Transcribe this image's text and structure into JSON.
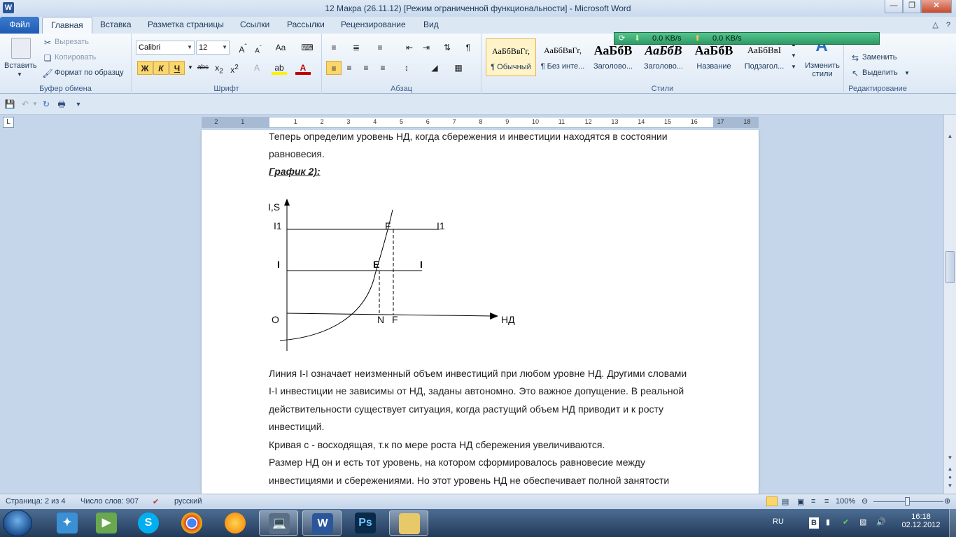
{
  "window": {
    "title": "12 Макра (26.11.12) [Режим ограниченной функциональности]  -  Microsoft Word",
    "app_icon": "W"
  },
  "tabs": {
    "file": "Файл",
    "items": [
      "Главная",
      "Вставка",
      "Разметка страницы",
      "Ссылки",
      "Рассылки",
      "Рецензирование",
      "Вид"
    ]
  },
  "ribbon": {
    "clipboard": {
      "paste": "Вставить",
      "cut": "Вырезать",
      "copy": "Копировать",
      "format_painter": "Формат по образцу",
      "label": "Буфер обмена"
    },
    "font": {
      "name": "Calibri",
      "size": "12",
      "bold": "Ж",
      "italic": "К",
      "underline": "Ч",
      "strike": "abc",
      "label": "Шрифт"
    },
    "paragraph": {
      "label": "Абзац"
    },
    "styles": {
      "items": [
        {
          "sample": "АаБбВвГг,",
          "name": "¶ Обычный"
        },
        {
          "sample": "АаБбВвГг,",
          "name": "¶ Без инте..."
        },
        {
          "sample": "АаБбВ",
          "name": "Заголово..."
        },
        {
          "sample": "АаБбВ",
          "name": "Заголово..."
        },
        {
          "sample": "АаБбВ",
          "name": "Название"
        },
        {
          "sample": "АаБбВвI",
          "name": "Подзагол..."
        }
      ],
      "change_styles": "Изменить стили",
      "label": "Стили"
    },
    "editing": {
      "replace": "Заменить",
      "select": "Выделить",
      "label": "Редактирование"
    }
  },
  "netmeter": {
    "down": "0.0 KB/s",
    "up": "0.0 KB/s"
  },
  "ruler": {
    "ticks": [
      "2",
      "1",
      "1",
      "2",
      "3",
      "4",
      "5",
      "6",
      "7",
      "8",
      "9",
      "10",
      "11",
      "12",
      "13",
      "14",
      "15",
      "16",
      "17",
      "18"
    ]
  },
  "document": {
    "lines_top": [
      "Теперь определим уровень НД, когда сбережения и инвестиции находятся в состоянии",
      "равновесия."
    ],
    "heading": "График 2):",
    "graph": {
      "y_axis": "I,S",
      "x_axis": "НД",
      "origin": "O",
      "i1_left": "I1",
      "i1_right": "I1",
      "i_left": "I",
      "i_right": "I",
      "point_e": "E",
      "point_f": "F",
      "x_n": "N",
      "x_f": "F"
    },
    "lines_bottom": [
      "Линия I-I означает неизменный объем инвестиций при любом уровне НД. Другими словами",
      "I-I инвестиции не зависимы от НД, заданы автономно. Это важное допущение. В реальной",
      "действительности существует ситуация, когда растущий объем НД приводит и к росту",
      "инвестиций.",
      "Кривая с - восходящая, т.к по мере роста НД сбережения увеличиваются.",
      "Размер НД он и есть тот уровень, на котором  сформировалось равновесие между",
      "инвестициями и сбережениями. Но этот уровень НД не обеспечивает полной занятости"
    ]
  },
  "statusbar": {
    "page": "Страница: 2 из 4",
    "words": "Число слов: 907",
    "language": "русский",
    "zoom": "100%"
  },
  "taskbar": {
    "lang": "RU",
    "time": "16:18",
    "date": "02.12.2012"
  },
  "colors": {
    "file_tab": "#1e5cb3",
    "accent": "#2b579a",
    "netmeter": "#2d9a66"
  }
}
